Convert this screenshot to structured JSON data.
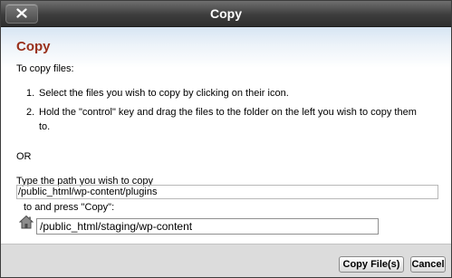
{
  "dialog": {
    "title": "Copy",
    "close_icon": "close-x-icon"
  },
  "content": {
    "heading": "Copy",
    "intro": "To copy files:",
    "steps": [
      {
        "number": "1.",
        "text": "Select the files you wish to copy by clicking on their icon."
      },
      {
        "number": "2.",
        "text": "Hold the \"control\" key and drag the files to the folder on the left you wish to copy them to."
      }
    ],
    "or_label": "OR",
    "path_prompt": "Type the path you wish to copy",
    "source_path": "/public_html/wp-content/plugins",
    "press_copy_text": "to and press \"Copy\":",
    "home_icon": "home-icon",
    "destination_path": "/public_html/staging/wp-content"
  },
  "footer": {
    "copy_button": "Copy File(s)",
    "cancel_button": "Cancel"
  }
}
